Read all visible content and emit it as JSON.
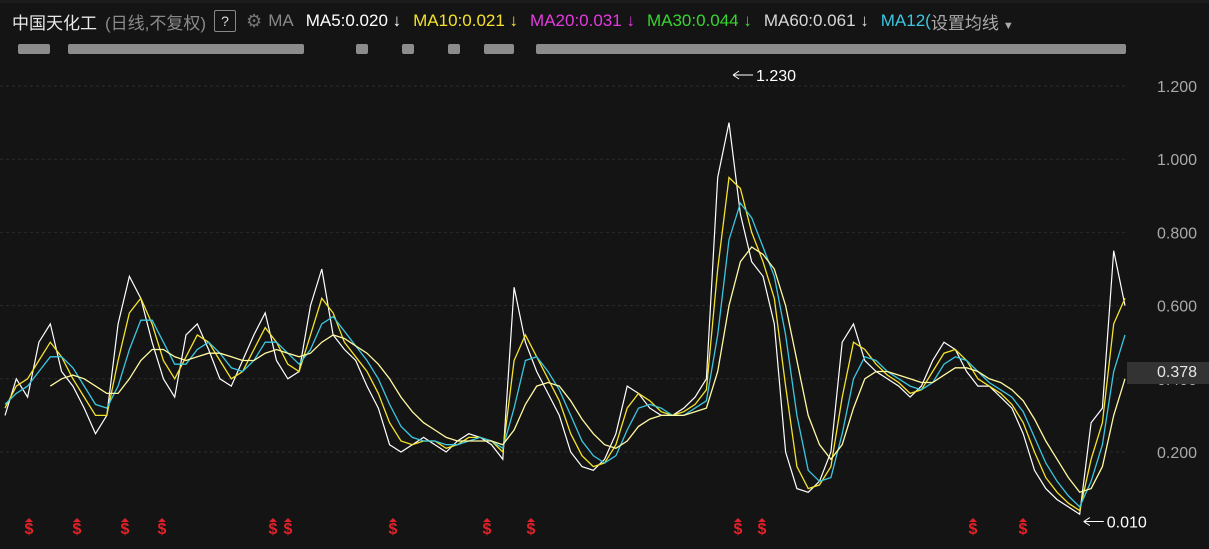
{
  "header": {
    "stock_name": "中国天化工",
    "mode": "(日线,不复权)",
    "help_label": "?",
    "ma_label": "MA",
    "ma_items": [
      {
        "label": "MA5:0.020",
        "arrow": "↓",
        "color": "#ffffff"
      },
      {
        "label": "MA10:0.021",
        "arrow": "↓",
        "color": "#f5e22a"
      },
      {
        "label": "MA20:0.031",
        "arrow": "↓",
        "color": "#e43be0"
      },
      {
        "label": "MA30:0.044",
        "arrow": "↓",
        "color": "#39d52f"
      },
      {
        "label": "MA60:0.061",
        "arrow": "↓",
        "color": "#d8d8d8"
      },
      {
        "label": "MA12(",
        "arrow": "",
        "color": "#3bc7e0"
      }
    ],
    "setting_label": "设置均线",
    "setting_icon": "caret-down-icon"
  },
  "price_tag": "0.378",
  "annotations": {
    "high": "1.230",
    "low": "0.010"
  },
  "chart_data": {
    "type": "line",
    "title": "",
    "ylim": [
      0.0,
      1.3
    ],
    "yticks": [
      "1.200",
      "1.000",
      "0.800",
      "0.600",
      "0.400",
      "0.200"
    ],
    "grid": true,
    "x_count": 100,
    "series": [
      {
        "color": "#ffffff",
        "values": [
          0.3,
          0.4,
          0.35,
          0.5,
          0.55,
          0.42,
          0.38,
          0.32,
          0.25,
          0.3,
          0.55,
          0.68,
          0.62,
          0.5,
          0.4,
          0.35,
          0.52,
          0.55,
          0.48,
          0.4,
          0.38,
          0.45,
          0.52,
          0.58,
          0.45,
          0.4,
          0.42,
          0.6,
          0.7,
          0.52,
          0.48,
          0.45,
          0.38,
          0.32,
          0.22,
          0.2,
          0.22,
          0.24,
          0.22,
          0.2,
          0.23,
          0.25,
          0.24,
          0.22,
          0.18,
          0.65,
          0.5,
          0.42,
          0.36,
          0.3,
          0.2,
          0.16,
          0.15,
          0.18,
          0.25,
          0.38,
          0.36,
          0.32,
          0.3,
          0.3,
          0.32,
          0.35,
          0.4,
          0.95,
          1.1,
          0.85,
          0.72,
          0.68,
          0.55,
          0.2,
          0.1,
          0.09,
          0.12,
          0.2,
          0.5,
          0.55,
          0.45,
          0.42,
          0.4,
          0.38,
          0.35,
          0.38,
          0.45,
          0.5,
          0.48,
          0.42,
          0.38,
          0.38,
          0.35,
          0.32,
          0.25,
          0.15,
          0.1,
          0.07,
          0.05,
          0.03,
          0.28,
          0.32,
          0.75,
          0.6
        ]
      },
      {
        "color": "#f5e22a",
        "values": [
          0.32,
          0.38,
          0.4,
          0.45,
          0.5,
          0.46,
          0.4,
          0.35,
          0.3,
          0.3,
          0.45,
          0.58,
          0.62,
          0.55,
          0.45,
          0.4,
          0.46,
          0.52,
          0.5,
          0.45,
          0.4,
          0.42,
          0.48,
          0.54,
          0.5,
          0.44,
          0.42,
          0.52,
          0.62,
          0.58,
          0.5,
          0.46,
          0.42,
          0.36,
          0.28,
          0.23,
          0.22,
          0.23,
          0.23,
          0.21,
          0.22,
          0.24,
          0.24,
          0.23,
          0.2,
          0.45,
          0.52,
          0.46,
          0.4,
          0.34,
          0.25,
          0.19,
          0.16,
          0.17,
          0.22,
          0.32,
          0.36,
          0.34,
          0.31,
          0.3,
          0.31,
          0.33,
          0.37,
          0.7,
          0.95,
          0.92,
          0.8,
          0.72,
          0.62,
          0.38,
          0.16,
          0.1,
          0.11,
          0.16,
          0.35,
          0.5,
          0.48,
          0.44,
          0.41,
          0.39,
          0.36,
          0.37,
          0.42,
          0.47,
          0.48,
          0.45,
          0.4,
          0.38,
          0.36,
          0.33,
          0.28,
          0.2,
          0.13,
          0.09,
          0.06,
          0.04,
          0.18,
          0.28,
          0.55,
          0.62
        ]
      },
      {
        "color": "#3bc7e0",
        "values": [
          0.33,
          0.36,
          0.38,
          0.42,
          0.46,
          0.46,
          0.43,
          0.38,
          0.33,
          0.32,
          0.38,
          0.48,
          0.56,
          0.56,
          0.5,
          0.44,
          0.44,
          0.48,
          0.5,
          0.47,
          0.43,
          0.42,
          0.45,
          0.5,
          0.5,
          0.47,
          0.44,
          0.48,
          0.55,
          0.57,
          0.53,
          0.49,
          0.45,
          0.4,
          0.33,
          0.27,
          0.24,
          0.23,
          0.23,
          0.22,
          0.22,
          0.23,
          0.24,
          0.23,
          0.21,
          0.32,
          0.45,
          0.46,
          0.42,
          0.37,
          0.3,
          0.23,
          0.19,
          0.17,
          0.19,
          0.26,
          0.32,
          0.33,
          0.32,
          0.3,
          0.3,
          0.32,
          0.34,
          0.52,
          0.78,
          0.88,
          0.84,
          0.76,
          0.68,
          0.52,
          0.3,
          0.15,
          0.12,
          0.13,
          0.25,
          0.4,
          0.46,
          0.45,
          0.42,
          0.4,
          0.38,
          0.37,
          0.39,
          0.44,
          0.46,
          0.45,
          0.42,
          0.39,
          0.37,
          0.35,
          0.31,
          0.24,
          0.17,
          0.12,
          0.08,
          0.05,
          0.12,
          0.22,
          0.42,
          0.52
        ]
      },
      {
        "color": "#fff9a0",
        "values": [
          null,
          null,
          null,
          null,
          0.38,
          0.4,
          0.41,
          0.4,
          0.38,
          0.36,
          0.36,
          0.4,
          0.45,
          0.48,
          0.48,
          0.46,
          0.45,
          0.46,
          0.47,
          0.47,
          0.46,
          0.45,
          0.45,
          0.47,
          0.48,
          0.47,
          0.46,
          0.47,
          0.5,
          0.52,
          0.51,
          0.49,
          0.47,
          0.44,
          0.4,
          0.35,
          0.31,
          0.28,
          0.26,
          0.24,
          0.23,
          0.23,
          0.23,
          0.23,
          0.22,
          0.26,
          0.33,
          0.38,
          0.39,
          0.38,
          0.34,
          0.29,
          0.25,
          0.22,
          0.21,
          0.23,
          0.27,
          0.29,
          0.3,
          0.3,
          0.3,
          0.31,
          0.32,
          0.42,
          0.6,
          0.72,
          0.76,
          0.74,
          0.7,
          0.6,
          0.45,
          0.3,
          0.22,
          0.18,
          0.22,
          0.32,
          0.4,
          0.42,
          0.42,
          0.41,
          0.4,
          0.39,
          0.39,
          0.41,
          0.43,
          0.43,
          0.42,
          0.4,
          0.39,
          0.37,
          0.34,
          0.29,
          0.23,
          0.18,
          0.13,
          0.09,
          0.1,
          0.16,
          0.3,
          0.4
        ]
      }
    ]
  },
  "signal_marker": "$"
}
